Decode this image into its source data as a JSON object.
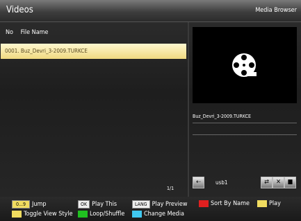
{
  "header": {
    "title": "Videos",
    "subtitle": "Media Browser"
  },
  "list": {
    "col_no": "No",
    "col_name": "File Name",
    "rows": [
      {
        "no": "0001.",
        "name": "Buz_Devri_3-2009.TURKCE"
      }
    ],
    "page": "1/1"
  },
  "preview": {
    "filename": "Buz_Devri_3-2009.TURKCE"
  },
  "source": {
    "label": "usb1"
  },
  "footer": {
    "jump_key": "0...9",
    "jump": "Jump",
    "ok_key": "OK",
    "play_this": "Play This",
    "lang_key": "LANG",
    "play_preview": "Play Preview",
    "sort": "Sort By Name",
    "play": "Play",
    "toggle": "Toggle View Style",
    "loop": "Loop/Shuffle",
    "change_media": "Change Media"
  },
  "colors": {
    "selection": "#f0d980",
    "red": "#e02020",
    "green": "#20c020",
    "blue": "#40c8f0",
    "yellow": "#f0dc60"
  }
}
